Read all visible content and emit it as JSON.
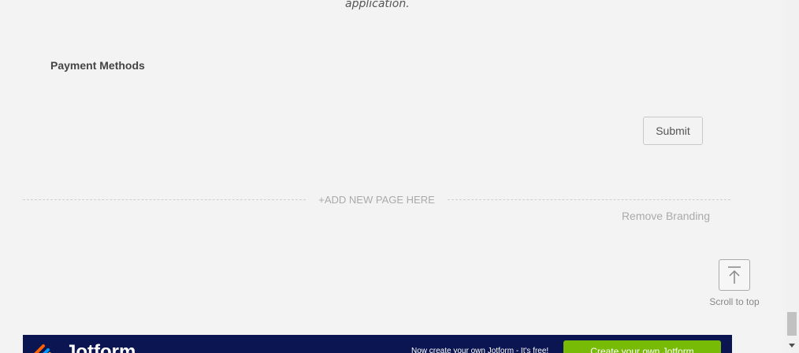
{
  "form": {
    "prev_text": "application.",
    "payment_label": "Payment Methods",
    "submit_label": "Submit",
    "add_page_label": "+ADD NEW PAGE HERE",
    "remove_branding": "Remove Branding",
    "scroll_to_top": "Scroll to top"
  },
  "banner": {
    "brand": "Jotform",
    "promo": "Now create your own Jotform - It's free!",
    "cta": "Create your own Jotform",
    "colors": {
      "background": "#0a1551",
      "cta": "#78bb07"
    }
  },
  "icons": {
    "scroll_top": "arrow-up-to-line-icon",
    "logo": "jotform-logo-icon",
    "scroll_down": "chevron-down-icon"
  }
}
